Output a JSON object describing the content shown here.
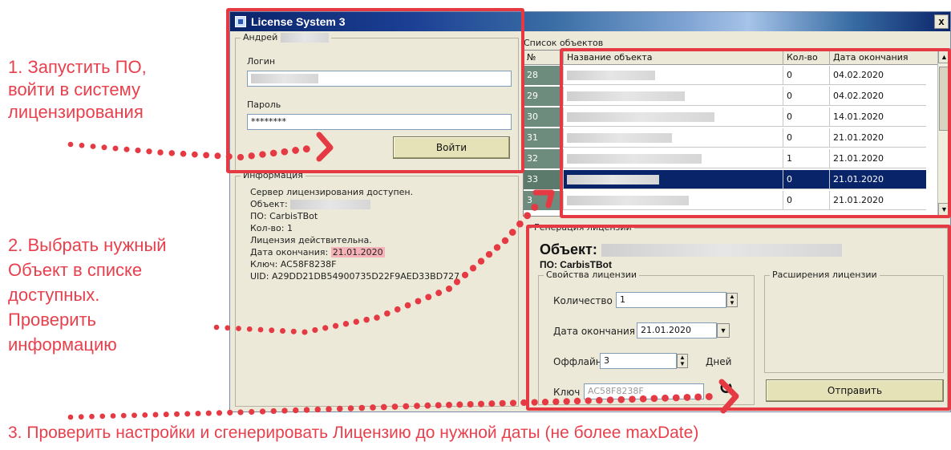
{
  "window": {
    "title": "License System 3",
    "close_label": "x"
  },
  "login": {
    "user_label": "Андрей",
    "login_label": "Логин",
    "password_label": "Пароль",
    "password_value": "********",
    "login_button": "Войти"
  },
  "info": {
    "group_label": "Информация",
    "lines": [
      "Сервер лицензирования доступен.",
      "Объект:",
      "ПО: CarbisTBot",
      "Кол-во: 1",
      "Лицензия действительна.",
      "Дата окончания: ",
      "Ключ: AC58F8238F",
      "UID: A29DD21DB54900735D22F9AED33BD727"
    ],
    "expiry_value": "21.01.2020"
  },
  "objects": {
    "group_label": "Список объектов",
    "columns": [
      "№",
      "Название объекта",
      "Кол-во",
      "Дата окончания"
    ],
    "rows": [
      {
        "num": "28",
        "qty": "0",
        "date": "04.02.2020"
      },
      {
        "num": "29",
        "qty": "0",
        "date": "04.02.2020"
      },
      {
        "num": "30",
        "qty": "0",
        "date": "14.01.2020"
      },
      {
        "num": "31",
        "qty": "0",
        "date": "21.01.2020"
      },
      {
        "num": "32",
        "qty": "1",
        "date": "21.01.2020"
      },
      {
        "num": "33",
        "qty": "0",
        "date": "21.01.2020"
      },
      {
        "num": "3",
        "qty": "0",
        "date": "21.01.2020"
      }
    ],
    "selected_row": 5
  },
  "generation": {
    "group_label": "Генерация лицензии",
    "object_label": "Объект:",
    "software_label": "ПО: CarbisTBot",
    "props_label": "Свойства лицензии",
    "ext_label": "Расширения лицензии",
    "quantity_label": "Количество",
    "quantity_value": "1",
    "expiry_label": "Дата окончания",
    "expiry_value": "21.01.2020",
    "offline_label": "Оффлайн",
    "offline_value": "3",
    "days_label": "Дней",
    "key_label": "Ключ",
    "key_value": "AC58F8238F",
    "send_button": "Отправить"
  },
  "annotations": {
    "step1": [
      "1. Запустить ПО,",
      "войти в систему",
      "лицензирования"
    ],
    "step2": [
      "2. Выбрать нужный",
      "Объект в списке",
      "доступных.",
      "Проверить",
      "информацию"
    ],
    "step3": "3. Проверить настройки и сгенерировать Лицензию до нужной даты (не более maxDate)"
  },
  "colors": {
    "annotation": "#e53a44",
    "selection": "#0a246a",
    "title_bar": "#0a246a"
  }
}
